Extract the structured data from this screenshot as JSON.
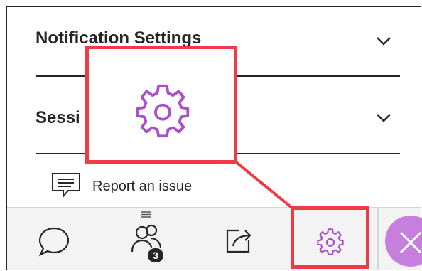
{
  "panel": {
    "sections": [
      {
        "title": "Notification Settings",
        "expanded": false,
        "icon": "chevron-down-icon"
      },
      {
        "title": "Sessi",
        "expanded": false,
        "icon": "chevron-down-icon"
      }
    ],
    "report_issue": {
      "label": "Report an issue",
      "icon": "feedback-icon"
    }
  },
  "bottom_bar": {
    "drag_handle_icon": "drag-handle-icon",
    "chat": {
      "icon": "chat-bubble-icon"
    },
    "attendees": {
      "icon": "people-icon",
      "badge": "3"
    },
    "share": {
      "icon": "share-content-icon"
    },
    "settings": {
      "icon": "gear-icon",
      "active": true
    },
    "close": {
      "icon": "close-icon"
    }
  },
  "annotation": {
    "highlight_color": "#ef3b46",
    "zoom_icon": "gear-icon"
  },
  "colors": {
    "accent_purple": "#a94fc9",
    "close_button_fill": "#c77fde",
    "text": "#262626",
    "bar_background": "#f3f3f3"
  }
}
